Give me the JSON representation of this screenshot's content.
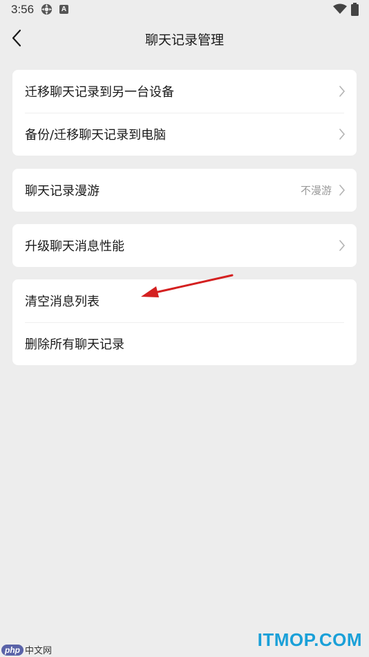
{
  "status_bar": {
    "time": "3:56",
    "app_icon_letter": "A",
    "icons": [
      "gear-icon",
      "app-a-icon",
      "wifi-icon",
      "battery-icon"
    ]
  },
  "nav": {
    "title": "聊天记录管理",
    "back_icon": "chevron-left-icon"
  },
  "groups": [
    {
      "items": [
        {
          "label": "迁移聊天记录到另一台设备",
          "chevron": true
        },
        {
          "label": "备份/迁移聊天记录到电脑",
          "chevron": true
        }
      ]
    },
    {
      "items": [
        {
          "label": "聊天记录漫游",
          "value": "不漫游",
          "chevron": true
        }
      ]
    },
    {
      "items": [
        {
          "label": "升级聊天消息性能",
          "chevron": true
        }
      ]
    },
    {
      "items": [
        {
          "label": "清空消息列表",
          "chevron": false
        },
        {
          "label": "删除所有聊天记录",
          "chevron": false
        }
      ]
    }
  ],
  "annotation": {
    "arrow_color": "#d42020"
  },
  "watermarks": {
    "left_badge": "php",
    "left_text": "中文网",
    "right_text": "ITMOP.COM"
  },
  "colors": {
    "background": "#ededed",
    "card": "#ffffff",
    "secondary_text": "#9a9a9a",
    "watermark_blue": "#1aa0d8"
  }
}
